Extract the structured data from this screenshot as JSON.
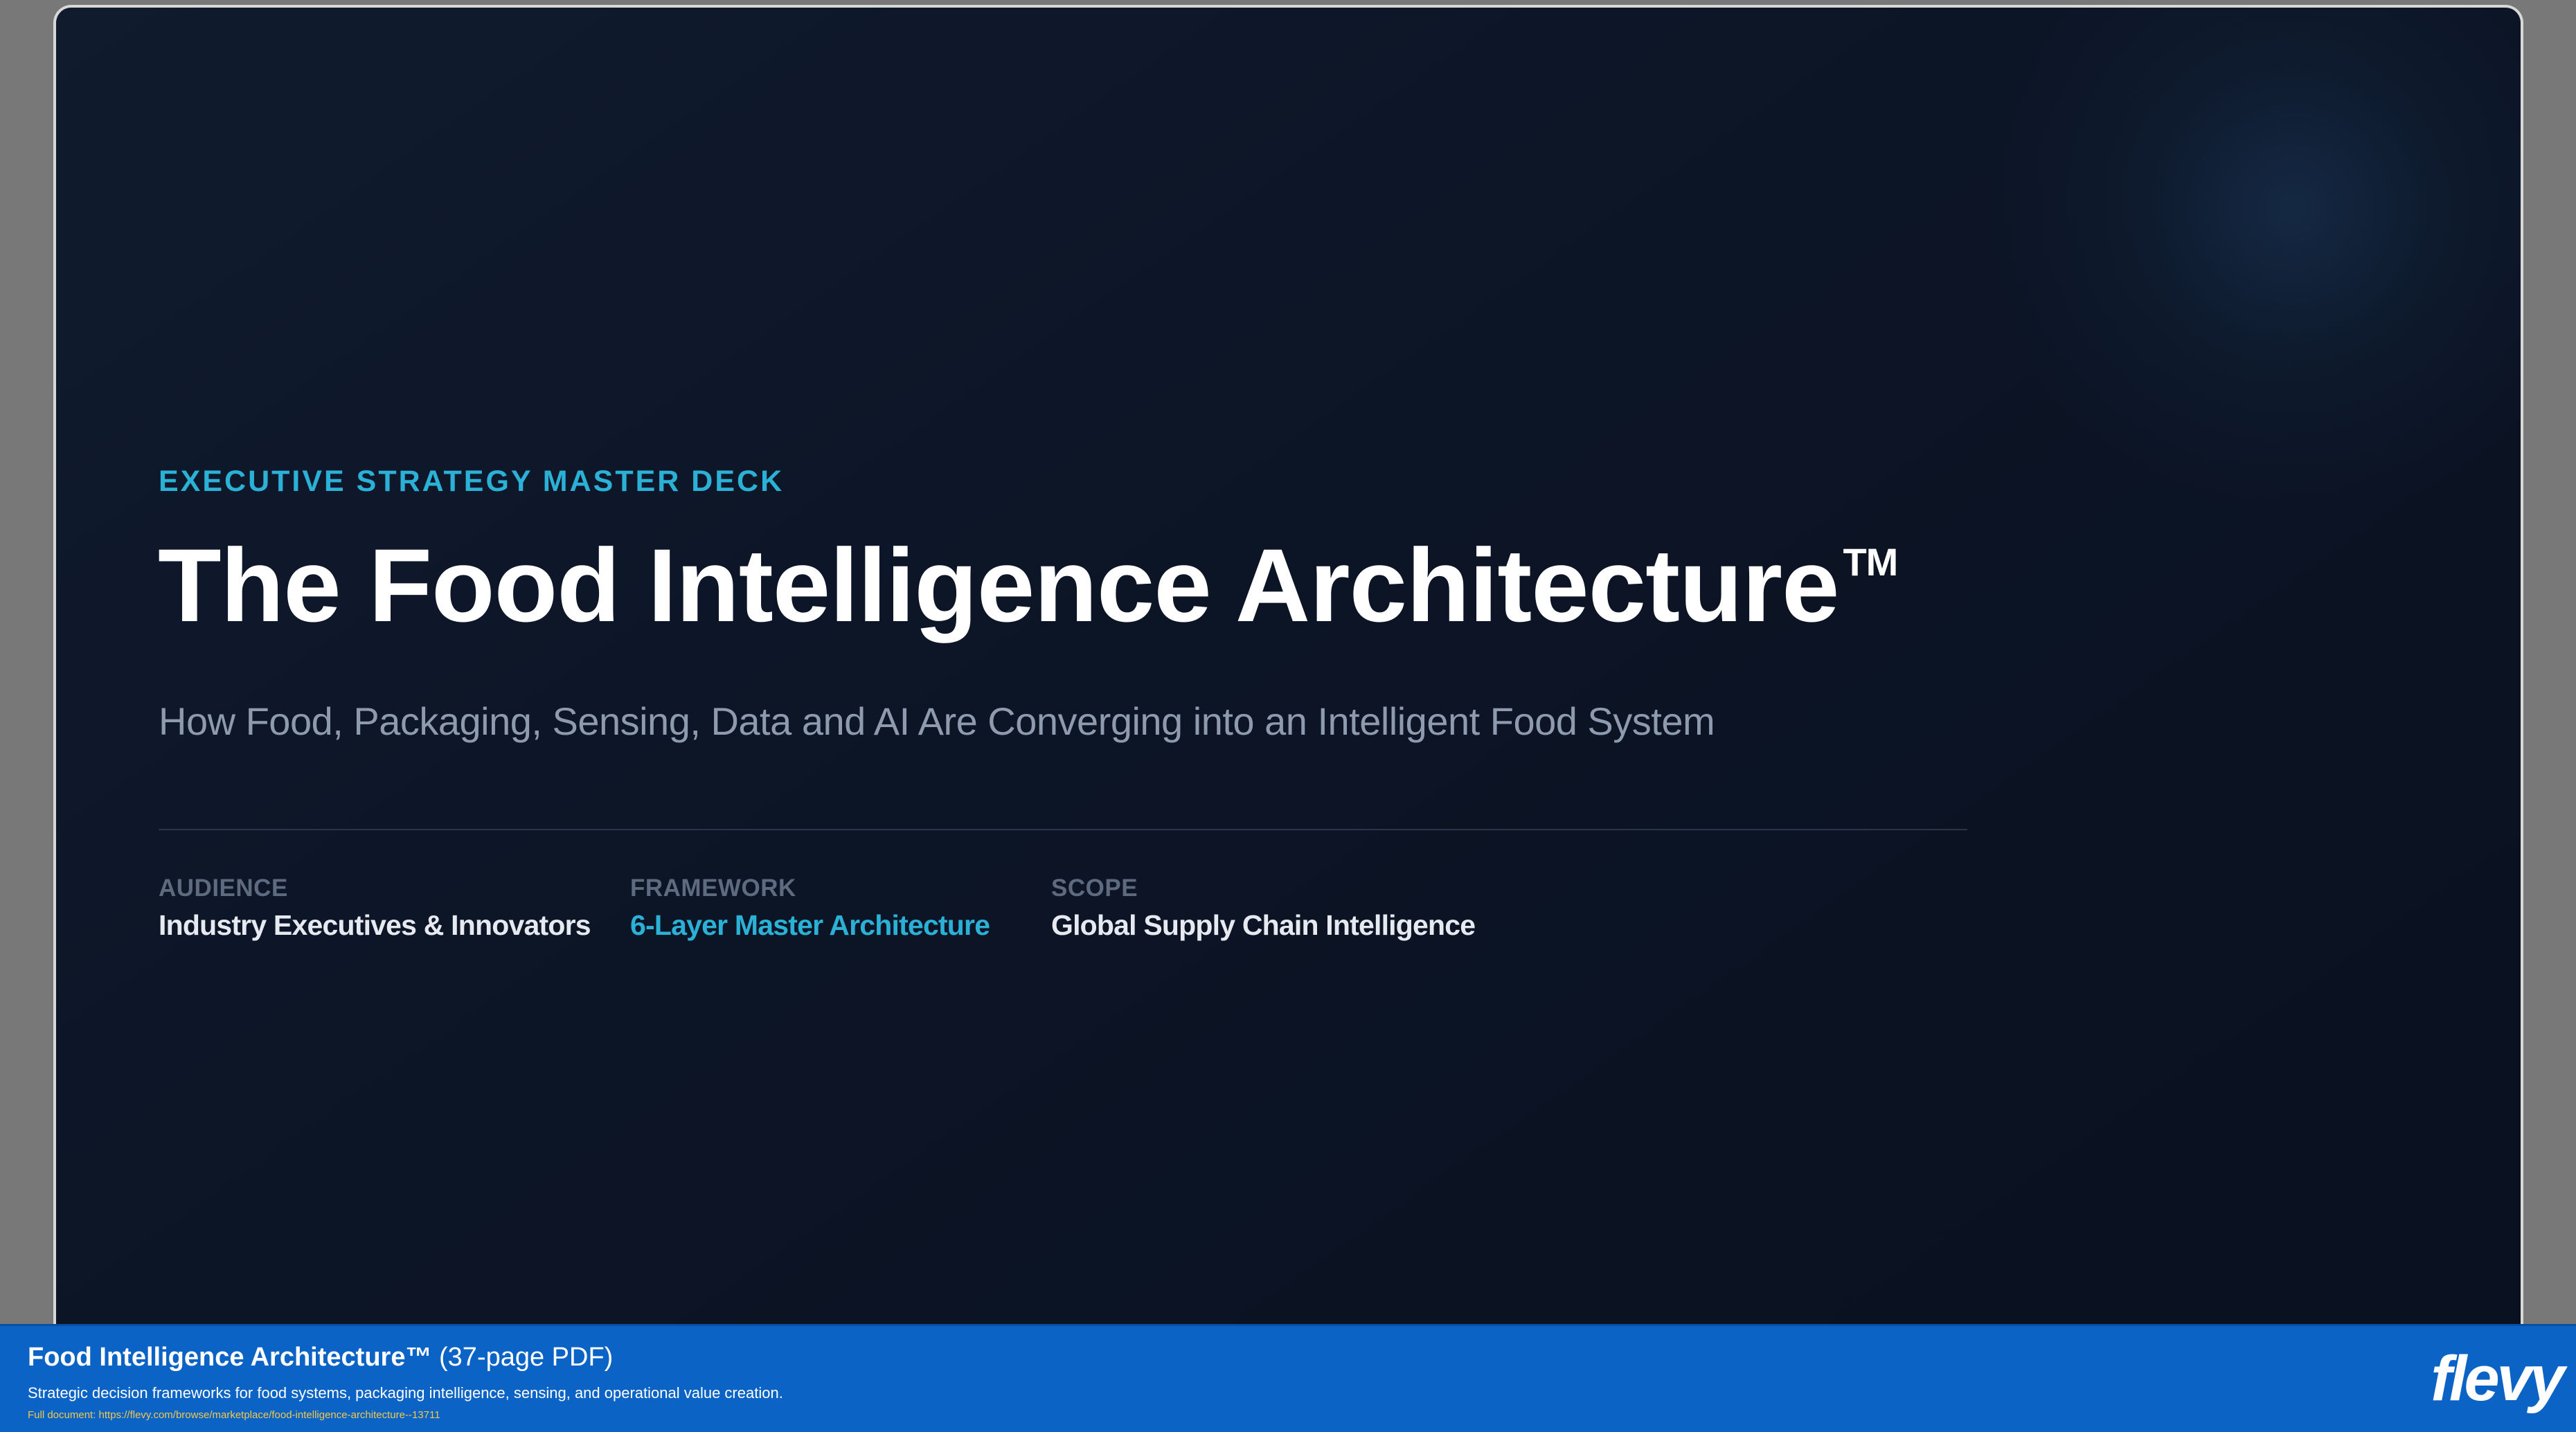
{
  "slide": {
    "eyebrow": "EXECUTIVE STRATEGY MASTER DECK",
    "title": "The Food Intelligence Architecture",
    "title_mark": "TM",
    "subtitle": "How Food, Packaging, Sensing, Data and AI Are Converging into an Intelligent Food System",
    "meta": [
      {
        "label": "AUDIENCE",
        "value": "Industry Executives & Innovators"
      },
      {
        "label": "FRAMEWORK",
        "value": "6-Layer Master Architecture"
      },
      {
        "label": "SCOPE",
        "value": "Global Supply Chain Intelligence"
      }
    ]
  },
  "footer": {
    "title": "Food Intelligence Architecture™",
    "pages": "(37-page PDF)",
    "description": "Strategic decision frameworks for food systems, packaging intelligence, sensing, and operational value creation.",
    "link": "Full document: https://flevy.com/browse/marketplace/food-intelligence-architecture--13711",
    "brand": "flevy"
  },
  "colors": {
    "accent": "#2bb0d6",
    "slide_background": "#0c1526",
    "footer_background": "#0b63c5",
    "link": "#f2c94c"
  }
}
